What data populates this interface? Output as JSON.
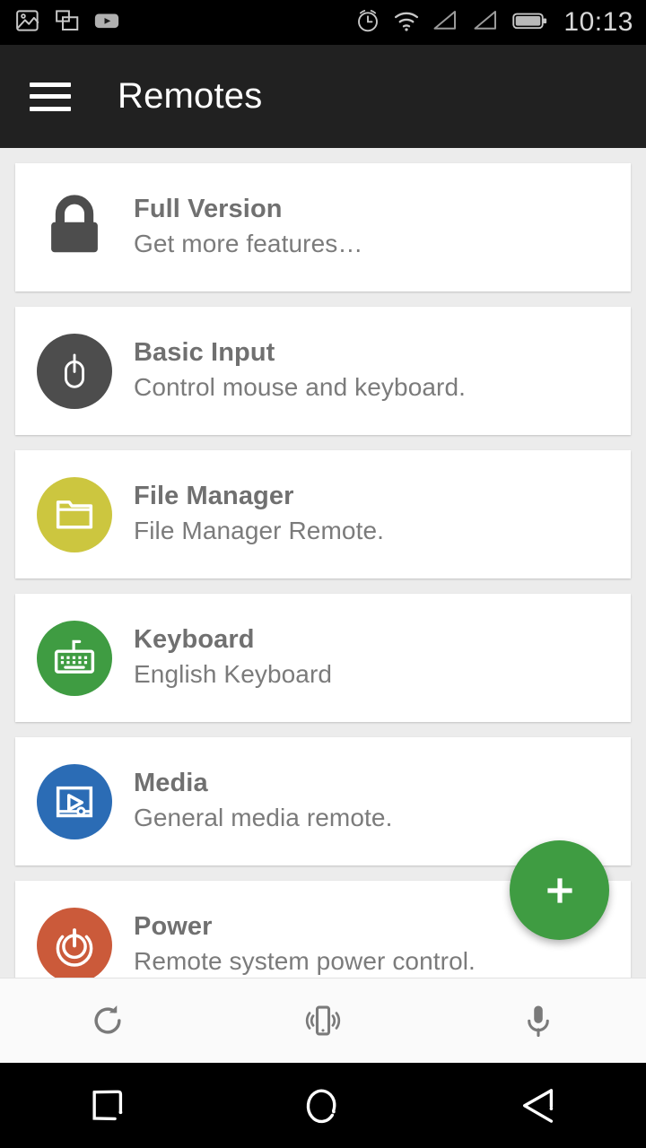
{
  "status_bar": {
    "time": "10:13",
    "left_icons": [
      "photo-icon",
      "screenshot-copy-icon",
      "youtube-icon"
    ],
    "right_icons": [
      "alarm-icon",
      "wifi-icon",
      "signal-sim1-icon",
      "signal-sim2-icon",
      "battery-icon"
    ]
  },
  "toolbar": {
    "menu_icon": "hamburger-icon",
    "title": "Remotes"
  },
  "colors": {
    "background": "#ececec",
    "toolbar": "#212121",
    "card": "#ffffff",
    "title_text": "#707070",
    "subtitle_text": "#7b7b7b",
    "fab": "#3f9c42",
    "lock_gray": "#4d4d4d",
    "mouse_gray": "#4d4d4d",
    "folder_yellow": "#ccc63f",
    "keyboard_green": "#3f9c42",
    "media_blue": "#2b6cb5",
    "power_red": "#cb5a3a"
  },
  "remotes": [
    {
      "title": "Full Version",
      "subtitle": "Get more features…",
      "icon": "lock-icon",
      "icon_style": "plain",
      "color": "#4d4d4d"
    },
    {
      "title": "Basic Input",
      "subtitle": "Control mouse and keyboard.",
      "icon": "mouse-icon",
      "icon_style": "circle",
      "color": "#4d4d4d"
    },
    {
      "title": "File Manager",
      "subtitle": "File Manager Remote.",
      "icon": "folder-icon",
      "icon_style": "circle",
      "color": "#ccc63f"
    },
    {
      "title": "Keyboard",
      "subtitle": "English Keyboard",
      "icon": "keyboard-icon",
      "icon_style": "circle",
      "color": "#3f9c42"
    },
    {
      "title": "Media",
      "subtitle": "General media remote.",
      "icon": "media-player-icon",
      "icon_style": "circle",
      "color": "#2b6cb5"
    },
    {
      "title": "Power",
      "subtitle": "Remote system power control.",
      "icon": "power-icon",
      "icon_style": "circle",
      "color": "#cb5a3a"
    }
  ],
  "fab": {
    "icon": "plus-icon",
    "label": "+"
  },
  "bottom_bar": {
    "items": [
      {
        "icon": "refresh-icon"
      },
      {
        "icon": "vibrate-phone-icon"
      },
      {
        "icon": "microphone-icon"
      }
    ]
  },
  "nav_bar": {
    "items": [
      {
        "icon": "recents-square-icon"
      },
      {
        "icon": "home-circle-icon"
      },
      {
        "icon": "back-triangle-icon"
      }
    ]
  }
}
